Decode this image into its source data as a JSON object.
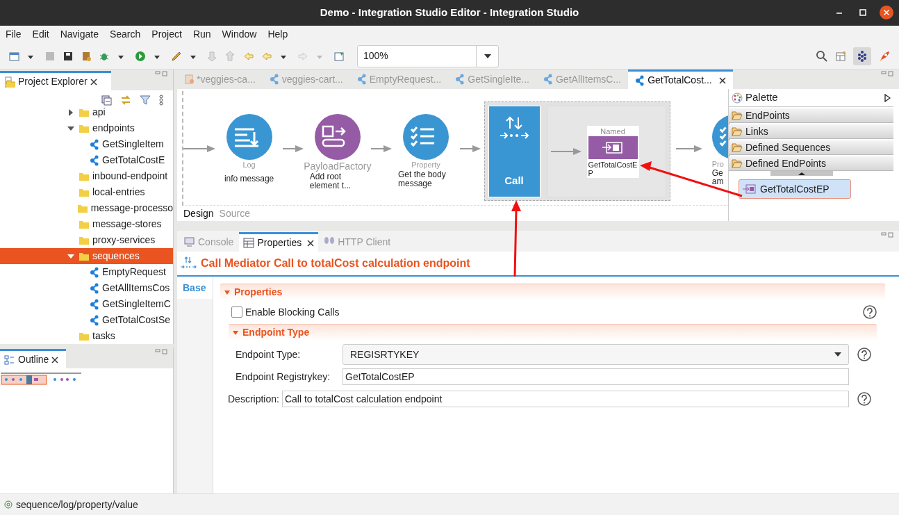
{
  "window": {
    "title": "Demo - Integration Studio Editor - Integration Studio"
  },
  "menu": [
    "File",
    "Edit",
    "Navigate",
    "Search",
    "Project",
    "Run",
    "Window",
    "Help"
  ],
  "toolbar": {
    "zoom": "100%"
  },
  "project_explorer": {
    "title": "Project Explorer",
    "tree": [
      {
        "label": "api",
        "kind": "folder",
        "expanded": false,
        "selected": false
      },
      {
        "label": "endpoints",
        "kind": "folder",
        "expanded": true,
        "selected": false,
        "children": [
          {
            "label": "GetSingleItem",
            "kind": "artifact",
            "selected": false
          },
          {
            "label": "GetTotalCostE",
            "kind": "artifact",
            "selected": false
          }
        ]
      },
      {
        "label": "inbound-endpoint",
        "kind": "folder",
        "selected": false
      },
      {
        "label": "local-entries",
        "kind": "folder",
        "selected": false
      },
      {
        "label": "message-processo",
        "kind": "folder",
        "selected": false
      },
      {
        "label": "message-stores",
        "kind": "folder",
        "selected": false
      },
      {
        "label": "proxy-services",
        "kind": "folder",
        "selected": false
      },
      {
        "label": "sequences",
        "kind": "folder",
        "expanded": true,
        "selected": true,
        "children": [
          {
            "label": "EmptyRequest",
            "kind": "artifact",
            "selected": false
          },
          {
            "label": "GetAllItemsCos",
            "kind": "artifact",
            "selected": false
          },
          {
            "label": "GetSingleItemC",
            "kind": "artifact",
            "selected": false
          },
          {
            "label": "GetTotalCostSe",
            "kind": "artifact",
            "selected": false
          }
        ]
      },
      {
        "label": "tasks",
        "kind": "folder",
        "selected": false
      }
    ]
  },
  "outline": {
    "title": "Outline"
  },
  "editor_tabs": [
    {
      "label": "*veggies-ca...",
      "kind": "api",
      "selected": false
    },
    {
      "label": "veggies-cart...",
      "kind": "sequence",
      "selected": false
    },
    {
      "label": "EmptyRequest...",
      "kind": "sequence",
      "selected": false
    },
    {
      "label": "GetSingleIte...",
      "kind": "sequence",
      "selected": false
    },
    {
      "label": "GetAllItemsC...",
      "kind": "sequence",
      "selected": false
    },
    {
      "label": "GetTotalCost...",
      "kind": "sequence",
      "selected": true
    }
  ],
  "diagram": {
    "nodes": [
      {
        "kind": "log",
        "type": "Log",
        "label": "info message"
      },
      {
        "kind": "payload",
        "type": "PayloadFactory",
        "label": "Add root element t..."
      },
      {
        "kind": "property",
        "type": "Property",
        "label": "Get the body message"
      },
      {
        "kind": "call",
        "label": "Call",
        "endpoint": {
          "type": "Named",
          "label": "GetTotalCostEP"
        }
      },
      {
        "kind": "partial",
        "type": "Pro",
        "label_lines": [
          "Ge",
          "am"
        ]
      }
    ]
  },
  "editor_modes": [
    {
      "label": "Design",
      "selected": true
    },
    {
      "label": "Source",
      "selected": false
    }
  ],
  "palette": {
    "title": "Palette",
    "drawers": [
      "EndPoints",
      "Links",
      "Defined Sequences",
      "Defined EndPoints"
    ],
    "items": [
      {
        "label": "GetTotalCostEP",
        "selected": true
      }
    ]
  },
  "bottom_tabs": [
    {
      "label": "Console",
      "kind": "console",
      "selected": false
    },
    {
      "label": "Properties",
      "kind": "properties",
      "selected": true
    },
    {
      "label": "HTTP Client",
      "kind": "http",
      "selected": false
    }
  ],
  "properties": {
    "heading": "Call Mediator Call to totalCost calculation endpoint",
    "side_tabs": [
      {
        "label": "Base",
        "selected": true
      }
    ],
    "section": "Properties",
    "blocking": {
      "label": "Enable Blocking Calls",
      "checked": false
    },
    "subsection": "Endpoint Type",
    "fields": [
      {
        "kind": "select",
        "label": "Endpoint Type:",
        "value": "REGISRTYKEY",
        "help": true
      },
      {
        "kind": "text",
        "label": "Endpoint Registrykey:",
        "value": "GetTotalCostEP",
        "help": false
      },
      {
        "kind": "text",
        "label": "Description:",
        "value": "Call to totalCost calculation endpoint",
        "help": true
      }
    ]
  },
  "status_bar": {
    "text": "sequence/log/property/value"
  }
}
